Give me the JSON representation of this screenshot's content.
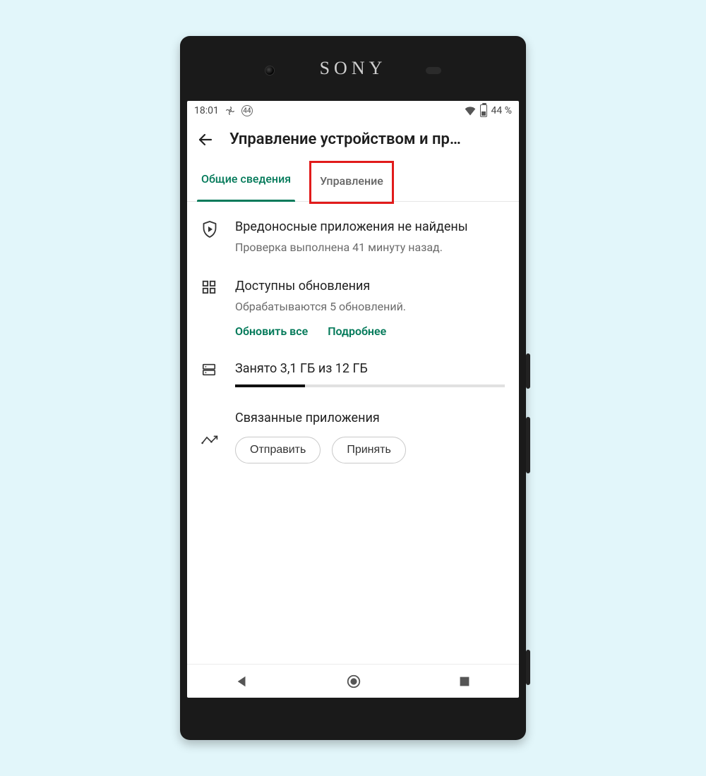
{
  "device": {
    "brand": "SONY"
  },
  "status": {
    "time": "18:01",
    "small_badge": "44",
    "battery_text": "44 %"
  },
  "header": {
    "title": "Управление устройством и пр…"
  },
  "tabs": {
    "overview": "Общие сведения",
    "manage": "Управление"
  },
  "protect": {
    "title": "Вредоносные приложения не найдены",
    "sub": "Проверка выполнена 41 минуту назад."
  },
  "updates": {
    "title": "Доступны обновления",
    "sub": "Обрабатываются 5 обновлений.",
    "update_all": "Обновить все",
    "details": "Подробнее"
  },
  "storage": {
    "text": "Занято 3,1 ГБ из 12 ГБ",
    "used_gb": 3.1,
    "total_gb": 12
  },
  "share": {
    "title": "Связанные приложения",
    "send": "Отправить",
    "receive": "Принять"
  }
}
